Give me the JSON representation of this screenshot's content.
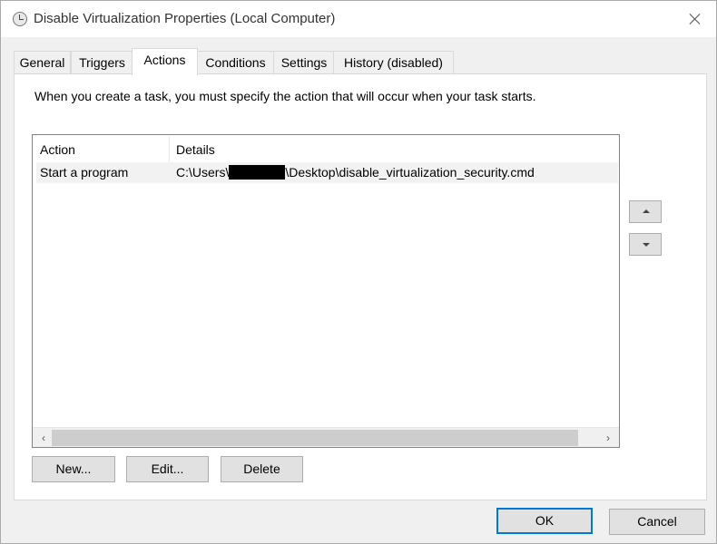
{
  "window": {
    "title": "Disable Virtualization Properties (Local Computer)"
  },
  "tabs": [
    {
      "label": "General"
    },
    {
      "label": "Triggers"
    },
    {
      "label": "Actions"
    },
    {
      "label": "Conditions"
    },
    {
      "label": "Settings"
    },
    {
      "label": "History (disabled)"
    }
  ],
  "actions": {
    "description": "When you create a task, you must specify the action that will occur when your task starts.",
    "columns": [
      "Action",
      "Details"
    ],
    "rows": [
      {
        "action": "Start a program",
        "details_prefix": "C:\\Users\\",
        "details_suffix": "\\Desktop\\disable_virtualization_security.cmd"
      }
    ],
    "new_label": "New...",
    "edit_label": "Edit...",
    "delete_label": "Delete"
  },
  "footer": {
    "ok_label": "OK",
    "cancel_label": "Cancel"
  }
}
